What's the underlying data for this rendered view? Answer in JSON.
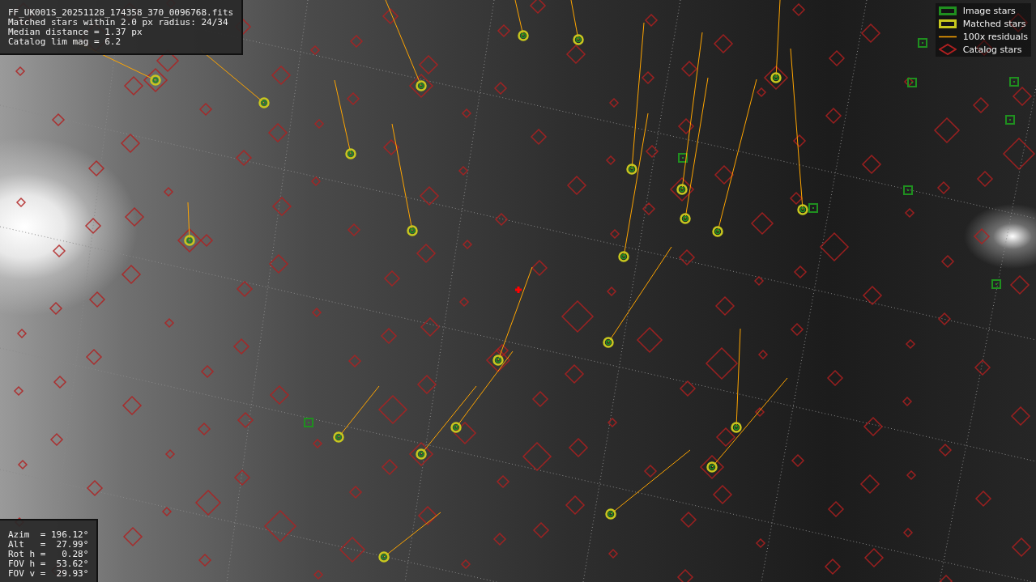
{
  "info_panel": {
    "lines": [
      "FF_UK001S_20251128_174358_370_0096768.fits",
      "Matched stars within 2.0 px radius: 24/34",
      "Median distance = 1.37 px",
      "Catalog lim mag = 6.2"
    ]
  },
  "legend": [
    {
      "kind": "box",
      "color": "#1f8f1f",
      "label": "Image stars"
    },
    {
      "kind": "box",
      "color": "#c8c81e",
      "label": "Matched stars"
    },
    {
      "kind": "line",
      "color": "#ffa500",
      "label": "100x residuals"
    },
    {
      "kind": "diamond",
      "color": "#b02020",
      "label": "Catalog stars"
    }
  ],
  "pointing_panel": {
    "lines": [
      "Azim  = 196.12°",
      "Alt   =  27.99°",
      "Rot h =   0.28°",
      "FOV h =  53.62°",
      "FOV v =  29.93°"
    ]
  }
}
